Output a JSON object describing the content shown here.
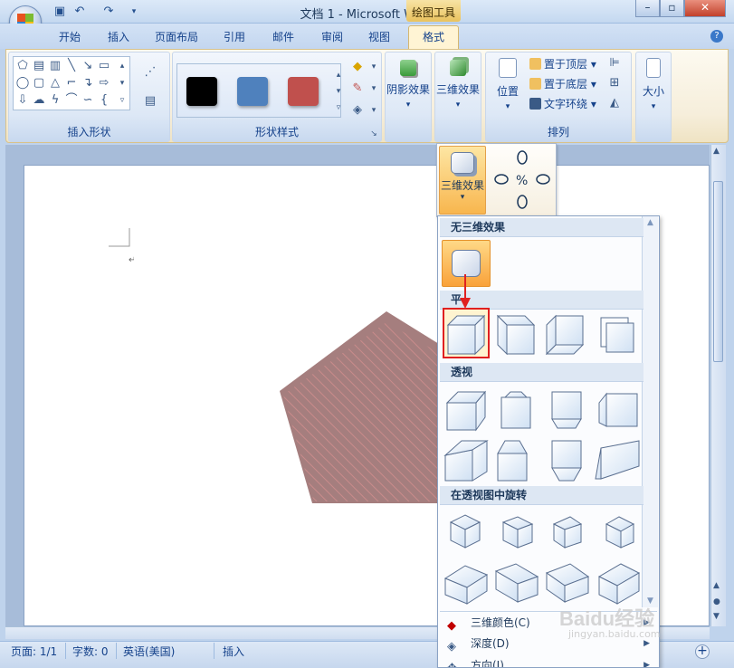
{
  "window": {
    "title": "文档 1 - Microsoft Word",
    "context_tab": "绘图工具"
  },
  "quick_access": [
    "save",
    "undo",
    "redo"
  ],
  "tabs": [
    "开始",
    "插入",
    "页面布局",
    "引用",
    "邮件",
    "审阅",
    "视图",
    "格式"
  ],
  "ribbon": {
    "groups": {
      "insert_shapes": "插入形状",
      "shape_styles": "形状样式",
      "shadow_effects": "阴影效果",
      "threed_effects": "三维效果",
      "arrange": "排列",
      "size": "大小"
    },
    "shadow_btn": "阴影效果",
    "threed_btn": "三维效果",
    "position_btn": "位置",
    "bring_front": "置于顶层",
    "send_back": "置于底层",
    "text_wrap": "文字环绕",
    "size_btn": "大小",
    "style_colors": [
      "#000000",
      "#4f81bd",
      "#c0504d"
    ]
  },
  "status": {
    "page": "页面: 1/1",
    "words": "字数: 0",
    "lang": "英语(美国)",
    "mode": "插入"
  },
  "dropdown": {
    "head_btn": "三维效果",
    "sections": {
      "none": "无三维效果",
      "parallel": "平",
      "perspective": "透视",
      "rotate": "在透视图中旋转"
    },
    "menu": {
      "color": "三维颜色(C)",
      "depth": "深度(D)",
      "direction": "方向(I)"
    }
  },
  "watermark": {
    "brand": "Baidu经验",
    "url": "jingyan.baidu.com"
  },
  "colors": {
    "highlight": "#ffb347",
    "select_border": "#e02020",
    "pentagon": "#c98b8b"
  }
}
